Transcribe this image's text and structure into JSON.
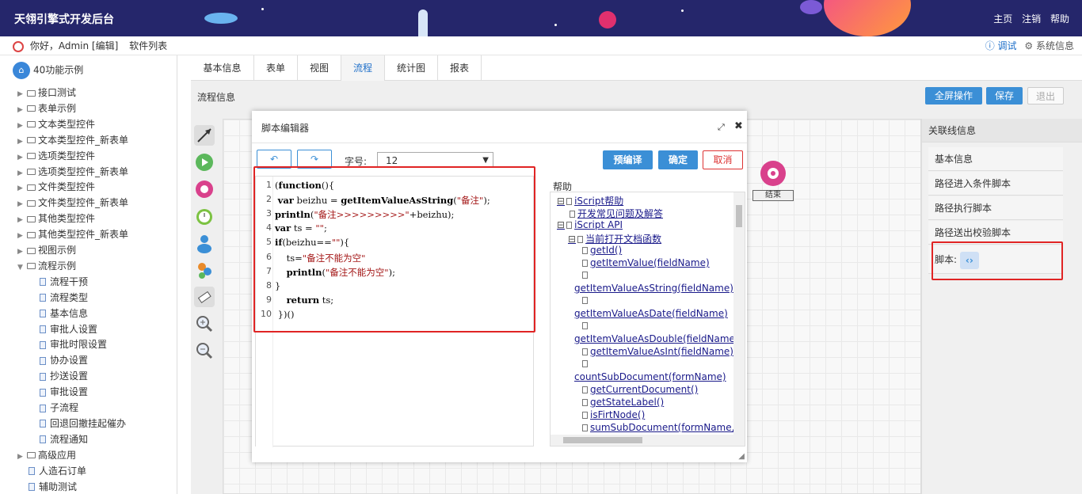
{
  "header": {
    "title": "天翎引擎式开发后台",
    "links": [
      "主页",
      "注销",
      "帮助"
    ]
  },
  "subbar": {
    "greeting": "你好，Admin [编辑]",
    "software_list": "软件列表",
    "debug": "调试",
    "system_info": "系统信息"
  },
  "sidebar": {
    "root": "40功能示例",
    "items": [
      {
        "label": "接口测试",
        "type": "folder"
      },
      {
        "label": "表单示例",
        "type": "folder"
      },
      {
        "label": "文本类型控件",
        "type": "folder"
      },
      {
        "label": "文本类型控件_新表单",
        "type": "folder"
      },
      {
        "label": "选项类型控件",
        "type": "folder"
      },
      {
        "label": "选项类型控件_新表单",
        "type": "folder"
      },
      {
        "label": "文件类型控件",
        "type": "folder"
      },
      {
        "label": "文件类型控件_新表单",
        "type": "folder"
      },
      {
        "label": "其他类型控件",
        "type": "folder"
      },
      {
        "label": "其他类型控件_新表单",
        "type": "folder"
      },
      {
        "label": "视图示例",
        "type": "folder"
      },
      {
        "label": "流程示例",
        "type": "folder-open"
      },
      {
        "label": "流程干预",
        "type": "doc"
      },
      {
        "label": "流程类型",
        "type": "doc"
      },
      {
        "label": "基本信息",
        "type": "doc"
      },
      {
        "label": "审批人设置",
        "type": "doc"
      },
      {
        "label": "审批时限设置",
        "type": "doc"
      },
      {
        "label": "协办设置",
        "type": "doc"
      },
      {
        "label": "抄送设置",
        "type": "doc"
      },
      {
        "label": "审批设置",
        "type": "doc"
      },
      {
        "label": "子流程",
        "type": "doc"
      },
      {
        "label": "回退回撤挂起催办",
        "type": "doc"
      },
      {
        "label": "流程通知",
        "type": "doc"
      },
      {
        "label": "高级应用",
        "type": "folder"
      },
      {
        "label": "人造石订单",
        "type": "doc-top"
      },
      {
        "label": "辅助测试",
        "type": "doc-top"
      }
    ]
  },
  "tabs": [
    "基本信息",
    "表单",
    "视图",
    "流程",
    "统计图",
    "报表"
  ],
  "flowbar": {
    "label": "流程信息",
    "fullscreen": "全屏操作",
    "save": "保存",
    "exit": "退出"
  },
  "end_node": "结束",
  "right_panel": {
    "header": "关联线信息",
    "items": [
      "基本信息",
      "路径进入条件脚本",
      "路径执行脚本",
      "路径送出校验脚本"
    ],
    "script_label": "脚本:"
  },
  "modal": {
    "title": "脚本编辑器",
    "font_size_label": "字号:",
    "font_size_value": "12",
    "precompile": "预编译",
    "confirm": "确定",
    "cancel": "取消",
    "help_label": "帮助",
    "code_lines": [
      "(function(){",
      " var beizhu = getItemValueAsString(\"备注\");",
      "println(\"备注>>>>>>>>>\"+beizhu);",
      "var ts = \"\";",
      "if(beizhu==\"\"){",
      "    ts=\"备注不能为空\"",
      "    println(\"备注不能为空\");",
      "}",
      "    return ts;",
      " })()"
    ],
    "help_tree": [
      "iScript帮助",
      "开发常见问题及解答",
      "iScript API",
      "当前打开文档函数",
      "getId()",
      "getItemValue(fieldName)",
      "getItemValueAsString(fieldName)",
      "getItemValueAsDate(fieldName)",
      "getItemValueAsDouble(fieldName)",
      "getItemValueAsInt(fieldName)",
      "countSubDocument(formName)",
      "getCurrentDocument()",
      "getStateLabel()",
      "isFirtNode()",
      "sumSubDocument(formName,"
    ]
  }
}
